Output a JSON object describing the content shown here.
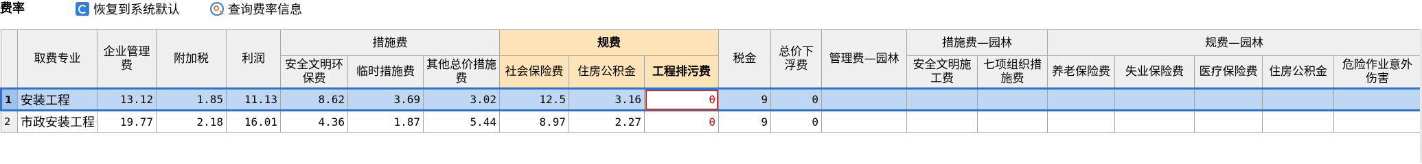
{
  "toolbar": {
    "title": "费率",
    "restore_label": "恢复到系统默认",
    "query_label": "查询费率信息"
  },
  "groups": {
    "measures": "措施费",
    "fees": "规费",
    "measures_garden": "措施费—园林",
    "fees_garden": "规费—园林"
  },
  "columns": {
    "specialty": "取费专业",
    "enterprise_mgmt": "企业管理费",
    "surtax": "附加税",
    "profit": "利润",
    "safety_civil": "安全文明环保费",
    "temp_measures": "临时措施费",
    "other_total_measures": "其他总价措施费",
    "social_insurance": "社会保险费",
    "housing_fund": "住房公积金",
    "pollution_fee": "工程排污费",
    "tax": "税金",
    "price_float": "总价下浮费",
    "mgmt_garden": "管理费—园林",
    "safety_civil_work": "安全文明施工费",
    "seven_org_measures": "七项组织措施费",
    "pension": "养老保险费",
    "unemployment": "失业保险费",
    "medical": "医疗保险费",
    "housing_fund_garden": "住房公积金",
    "hazard_injury": "危险作业意外伤害"
  },
  "rows": [
    {
      "no": "1",
      "specialty": "安装工程",
      "enterprise_mgmt": "13.12",
      "surtax": "1.85",
      "profit": "11.13",
      "safety_civil": "8.62",
      "temp_measures": "3.69",
      "other_total_measures": "3.02",
      "social_insurance": "12.5",
      "housing_fund": "3.16",
      "pollution_fee": "0",
      "tax": "9",
      "price_float": "0",
      "mgmt_garden": "",
      "safety_civil_work": "",
      "seven_org_measures": "",
      "pension": "",
      "unemployment": "",
      "medical": "",
      "housing_fund_garden": "",
      "hazard_injury": ""
    },
    {
      "no": "2",
      "specialty": "市政安装工程",
      "enterprise_mgmt": "19.77",
      "surtax": "2.18",
      "profit": "16.01",
      "safety_civil": "4.36",
      "temp_measures": "1.87",
      "other_total_measures": "5.44",
      "social_insurance": "8.97",
      "housing_fund": "2.27",
      "pollution_fee": "0",
      "tax": "9",
      "price_float": "0",
      "mgmt_garden": "",
      "safety_civil_work": "",
      "seven_org_measures": "",
      "pension": "",
      "unemployment": "",
      "medical": "",
      "housing_fund_garden": "",
      "hazard_injury": ""
    }
  ],
  "colors": {
    "header_bg": "#f0f0f0",
    "highlight_header": "#fde3b8",
    "selected_row": "#bdd7f5",
    "zero_red": "#e60000",
    "accent_blue": "#2f7fd8"
  }
}
